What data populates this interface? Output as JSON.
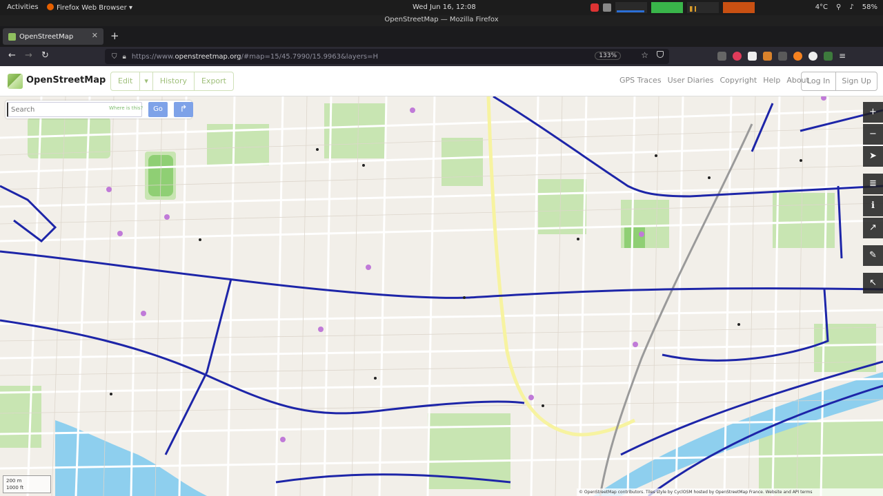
{
  "system_bar": {
    "activities": "Activities",
    "app_menu": "Firefox Web Browser",
    "clock": "Wed Jun 16, 12:08",
    "volume": "4°C",
    "battery": "58%"
  },
  "window": {
    "title": "OpenStreetMap — Mozilla Firefox"
  },
  "tabs": [
    {
      "label": "OpenStreetMap"
    }
  ],
  "url": {
    "prefix": "https://www.",
    "host": "openstreetmap.org",
    "path": "/#map=15/45.7990/15.9963&layers=H",
    "zoom": "133%"
  },
  "osm": {
    "site_name": "OpenStreetMap",
    "edit_group": {
      "edit": "Edit",
      "history": "History",
      "export": "Export"
    },
    "nav_links": [
      "GPS Traces",
      "User Diaries",
      "Copyright",
      "Help",
      "About"
    ],
    "auth": {
      "login": "Log In",
      "signup": "Sign Up"
    },
    "search": {
      "placeholder": "Search",
      "where_link": "Where is this?",
      "go": "Go"
    },
    "scale": {
      "metric": "200 m",
      "imperial": "1000 ft"
    },
    "attribution": "© OpenStreetMap contributors. Tiles style by CyclOSM hosted by OpenStreetMap France. Website and API terms"
  },
  "colors": {
    "map_bg": "#f2efe9",
    "road": "#ffffff",
    "cycle_route": "#1d25a8",
    "park": "#a7d68f",
    "river": "#7fc6ea"
  }
}
